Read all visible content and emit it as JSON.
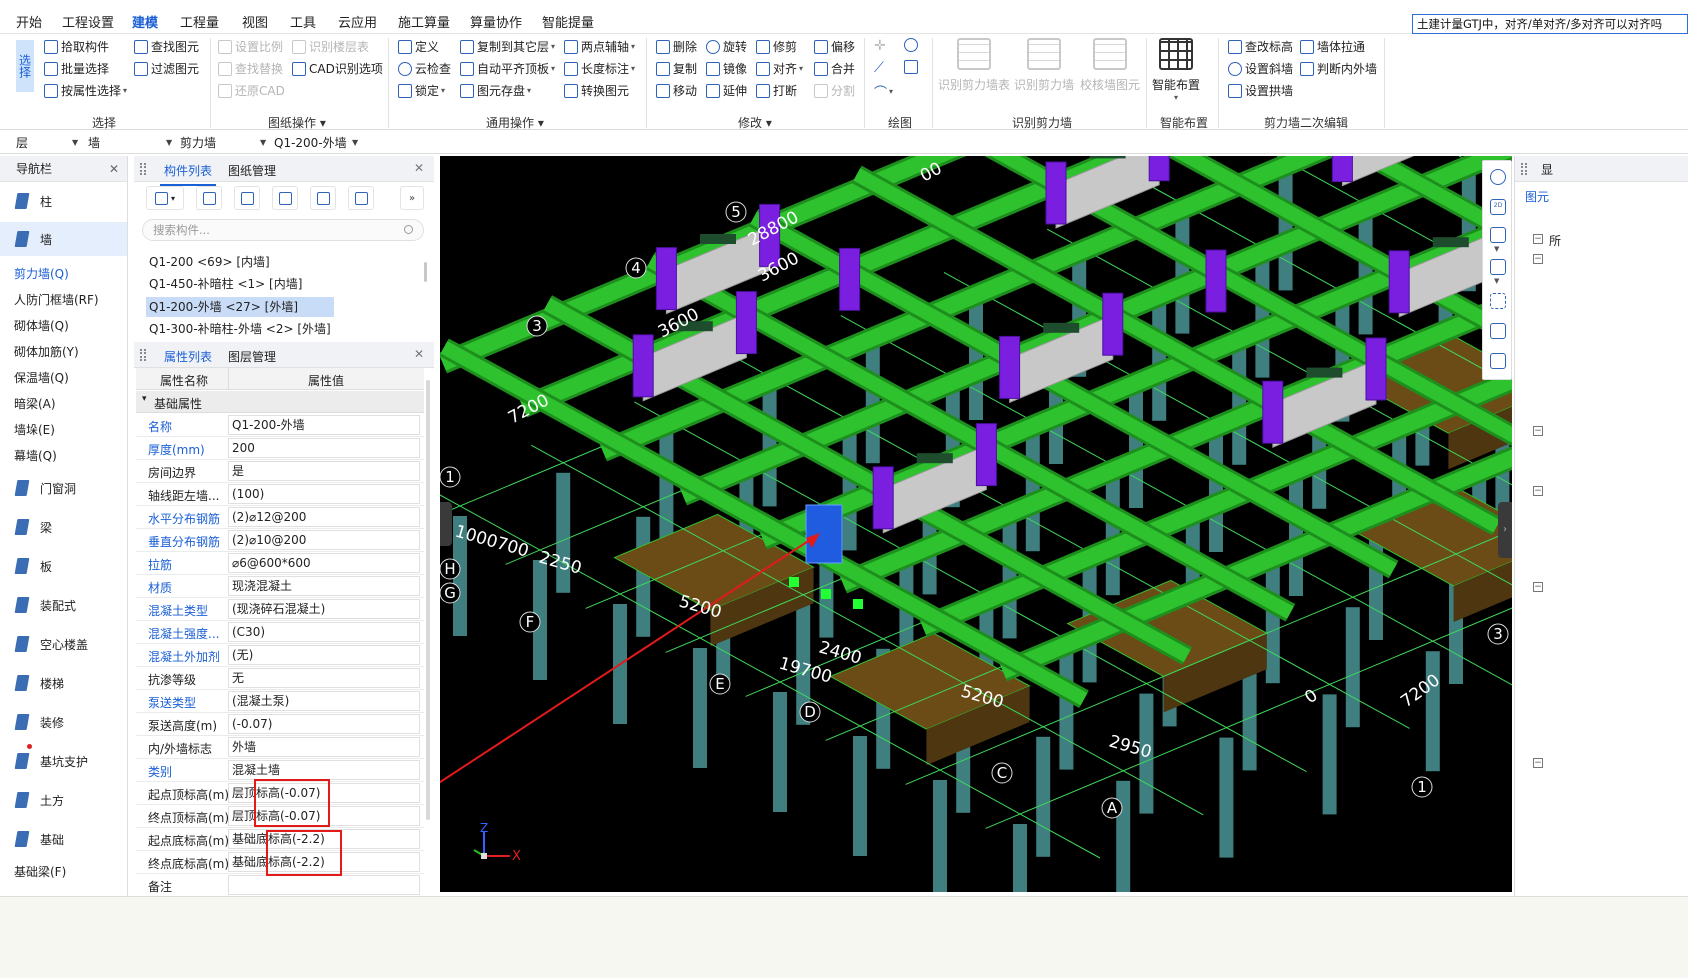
{
  "menu": {
    "items": [
      "开始",
      "工程设置",
      "建模",
      "工程量",
      "视图",
      "工具",
      "云应用",
      "施工算量",
      "算量协作",
      "智能提量"
    ],
    "active_index": 2,
    "search_tip": "土建计量GTJ中，对齐/单对齐/多对齐可以对齐吗"
  },
  "ribbon": {
    "select_big": "选择",
    "select": {
      "pick": "拾取构件",
      "batch": "批量选择",
      "by_attr": "按属性选择",
      "find": "查找图元",
      "filter": "过滤图元",
      "group": "选择"
    },
    "drawing": {
      "set_scale": "设置比例",
      "detect_floor": "识别楼层表",
      "find_replace": "查找替换",
      "cad_options": "CAD识别选项",
      "restore_cad": "还原CAD",
      "group": "图纸操作"
    },
    "common": {
      "define": "定义",
      "copy_other": "复制到其它层",
      "two_point_axis": "两点辅轴",
      "cloud_check": "云检查",
      "auto_flat_top": "自动平齐顶板",
      "length_mark": "长度标注",
      "lock": "锁定",
      "elem_save": "图元存盘",
      "convert": "转换图元",
      "group": "通用操作"
    },
    "modify": {
      "delete": "删除",
      "rotate": "旋转",
      "trim": "修剪",
      "offset": "偏移",
      "copy": "复制",
      "mirror": "镜像",
      "align": "对齐",
      "merge": "合并",
      "move": "移动",
      "extend": "延伸",
      "break": "打断",
      "split": "分割",
      "group": "修改"
    },
    "draw": {
      "group": "绘图"
    },
    "detect_wall": {
      "table": "识别剪力墙表",
      "wall": "识别剪力墙",
      "verify": "校核墙图元",
      "group": "识别剪力墙"
    },
    "smart": {
      "layout": "智能布置",
      "group": "智能布置"
    },
    "secondary": {
      "check_elev": "查改标高",
      "wall_pull": "墙体拉通",
      "set_slope": "设置斜墙",
      "judge_inner_outer": "判断内外墙",
      "set_arch": "设置拱墙",
      "group": "剪力墙二次编辑"
    }
  },
  "filterbar": {
    "floor": "层",
    "type": "墙",
    "subtype": "剪力墙",
    "component": "Q1-200-外墙"
  },
  "nav": {
    "title": "导航栏",
    "categories": [
      {
        "label": "柱",
        "top": 0
      },
      {
        "label": "墙",
        "top": 0
      }
    ],
    "wall_items": [
      "剪力墙(Q)",
      "人防门框墙(RF)",
      "砌体墙(Q)",
      "砌体加筋(Y)",
      "保温墙(Q)",
      "暗梁(A)",
      "墙垛(E)",
      "幕墙(Q)"
    ],
    "lower": [
      "门窗洞",
      "梁",
      "板",
      "装配式",
      "空心楼盖",
      "楼梯",
      "装修",
      "基坑支护",
      "土方",
      "基础"
    ],
    "last": "基础梁(F)"
  },
  "comp_panel": {
    "tabs": [
      "构件列表",
      "图纸管理"
    ],
    "search_placeholder": "搜索构件...",
    "items": [
      "Q1-200 <69> [内墙]",
      "Q1-450-补暗柱 <1> [内墙]",
      "Q1-200-外墙 <27> [外墙]",
      "Q1-300-补暗柱-外墙 <2> [外墙]"
    ],
    "selected_index": 2
  },
  "prop_panel": {
    "tabs": [
      "属性列表",
      "图层管理"
    ],
    "col_name": "属性名称",
    "col_value": "属性值",
    "section": "基础属性",
    "rows": [
      {
        "name": "名称",
        "value": "Q1-200-外墙",
        "blue": true
      },
      {
        "name": "厚度(mm)",
        "value": "200",
        "blue": true
      },
      {
        "name": "房间边界",
        "value": "是",
        "blue": false
      },
      {
        "name": "轴线距左墙...",
        "value": "(100)",
        "blue": false
      },
      {
        "name": "水平分布钢筋",
        "value": "(2)⌀12@200",
        "blue": true
      },
      {
        "name": "垂直分布钢筋",
        "value": "(2)⌀10@200",
        "blue": true
      },
      {
        "name": "拉筋",
        "value": "⌀6@600*600",
        "blue": true
      },
      {
        "name": "材质",
        "value": "现浇混凝土",
        "blue": true
      },
      {
        "name": "混凝土类型",
        "value": "(现浇碎石混凝土)",
        "blue": true
      },
      {
        "name": "混凝土强度...",
        "value": "(C30)",
        "blue": true
      },
      {
        "name": "混凝土外加剂",
        "value": "(无)",
        "blue": true
      },
      {
        "name": "抗渗等级",
        "value": "无",
        "blue": false
      },
      {
        "name": "泵送类型",
        "value": "(混凝土泵)",
        "blue": true
      },
      {
        "name": "泵送高度(m)",
        "value": "(-0.07)",
        "blue": false
      },
      {
        "name": "内/外墙标志",
        "value": "外墙",
        "blue": false
      },
      {
        "name": "类别",
        "value": "混凝土墙",
        "blue": true
      },
      {
        "name": "起点顶标高(m)",
        "value": "层顶标高(-0.07)",
        "blue": false
      },
      {
        "name": "终点顶标高(m)",
        "value": "层顶标高(-0.07)",
        "blue": false
      },
      {
        "name": "起点底标高(m)",
        "value": "基础底标高(-2.2)",
        "blue": false
      },
      {
        "name": "终点底标高(m)",
        "value": "基础底标高(-2.2)",
        "blue": false
      },
      {
        "name": "备注",
        "value": "",
        "blue": false
      }
    ]
  },
  "viewport": {
    "axis_labels": [
      "5",
      "4",
      "3",
      "1",
      "H",
      "G",
      "F",
      "E",
      "D",
      "C",
      "A",
      "1",
      "3"
    ],
    "dimensions": [
      "28800",
      "3600",
      "3600",
      "7200",
      "1000700",
      "2250",
      "5200",
      "2400",
      "19700",
      "5200",
      "2950",
      "7200",
      "00",
      "0"
    ],
    "triad": {
      "x": "X",
      "z": "Z"
    },
    "colors": {
      "beam": "#2fc22f",
      "column": "#7a1fe0",
      "wall": "#c8c8c8",
      "cap": "#6b4c16",
      "pile": "#3f7f80",
      "selected": "#1f5ce0",
      "annotation": "#e21a1a"
    }
  },
  "right_panel": {
    "title": "显",
    "tab": "图元",
    "check": "所"
  }
}
